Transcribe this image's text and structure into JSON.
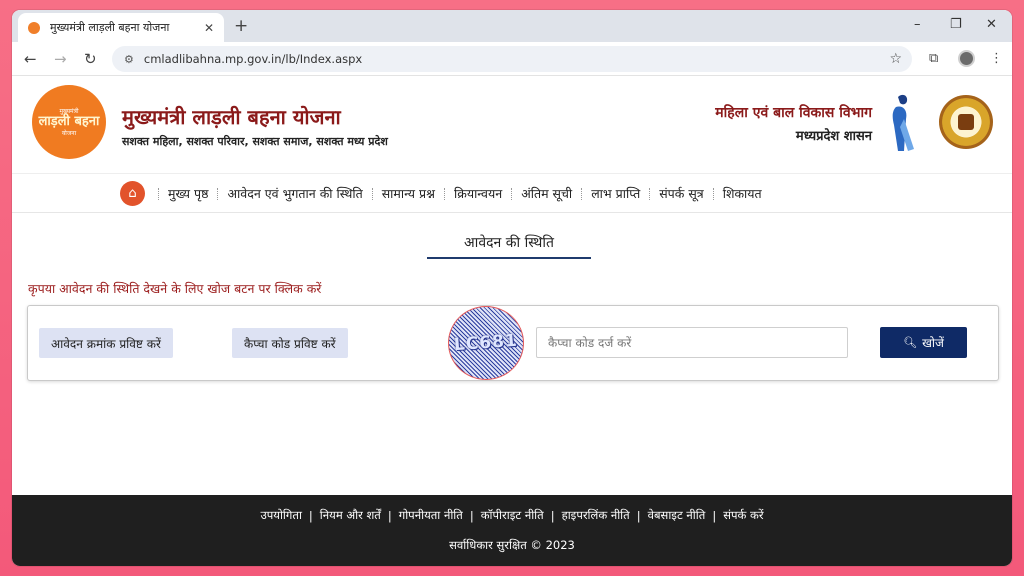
{
  "browser": {
    "tab_title": "मुख्यमंत्री लाड़ली बहना योजना",
    "tab_close": "✕",
    "new_tab": "+",
    "window_controls": [
      "–",
      "❐",
      "✕"
    ],
    "url": "cmladlibahna.mp.gov.in/lb/Index.aspx",
    "nav_icons": [
      "←",
      "→",
      "↻"
    ],
    "toolbar_icons": [
      "☆",
      "⧉",
      "⋮"
    ]
  },
  "header": {
    "logo": {
      "top": "मुख्यमंत्री",
      "big": "लाड़ली बहना",
      "bottom": "योजना"
    },
    "title": "मुख्यमंत्री लाड़ली बहना योजना",
    "subtitle": "सशक्त महिला, सशक्त परिवार, सशक्त समाज, सशक्त मध्य प्रदेश",
    "dept_name": "महिला एवं बाल विकास विभाग",
    "dept_gov": "मध्यप्रदेश शासन"
  },
  "nav": {
    "home_icon": "⌂",
    "items": [
      "मुख्य पृष्ठ",
      "आवेदन एवं भुगतान की स्थिति",
      "सामान्य प्रश्न",
      "क्रियान्वयन",
      "अंतिम सूची",
      "लाभ प्राप्ति",
      "संपर्क सूत्र",
      "शिकायत"
    ]
  },
  "main": {
    "section_title": "आवेदन की स्थिति",
    "instruction": "कृपया आवेदन की स्थिति देखने के लिए खोज बटन पर क्लिक करें",
    "application_button": "आवेदन क्रमांक प्रविष्ट करें",
    "captcha_button": "कैप्चा कोड प्रविष्ट करें",
    "captcha_text": "LC681",
    "captcha_placeholder": "कैप्चा कोड दर्ज करें",
    "search_button": "खोजें"
  },
  "footer": {
    "links": [
      "उपयोगिता",
      "नियम और शर्तें",
      "गोपनीयता नीति",
      "कॉपीराइट नीति",
      "हाइपरलिंक नीति",
      "वेबसाइट नीति",
      "संपर्क करें"
    ],
    "separator": "|",
    "copyright": "सर्वाधिकार सुरक्षित © 2023"
  },
  "colors": {
    "accent_maroon": "#8b1a1a",
    "nav_home": "#e2532b",
    "search_button": "#0f2a66",
    "footer_bg": "#1f1f1f",
    "logo_orange": "#f07b21"
  }
}
